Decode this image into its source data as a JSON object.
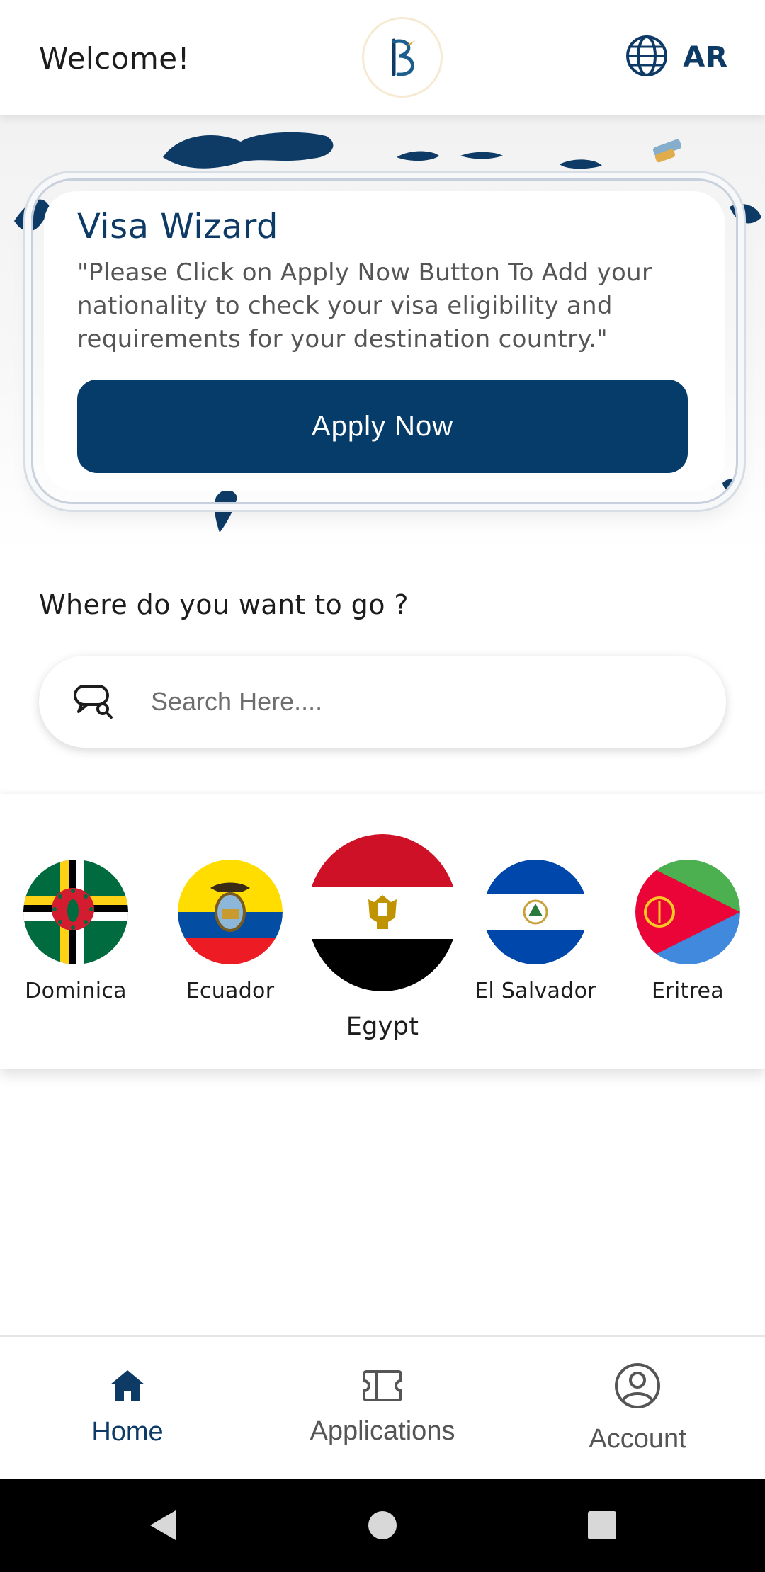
{
  "header": {
    "welcome": "Welcome!",
    "language_label": "AR"
  },
  "wizard": {
    "title": "Visa Wizard",
    "text": "\"Please Click on Apply Now Button To Add your nationality to check your visa eligibility and requirements for your destination country.\"",
    "apply_label": "Apply Now"
  },
  "destination": {
    "title": "Where do you want to go ?",
    "search_placeholder": "Search Here...."
  },
  "countries": [
    {
      "name": "Dominica"
    },
    {
      "name": "Ecuador"
    },
    {
      "name": "Egypt",
      "selected": true
    },
    {
      "name": "El Salvador"
    },
    {
      "name": "Eritrea"
    }
  ],
  "nav": {
    "home": "Home",
    "applications": "Applications",
    "account": "Account"
  },
  "colors": {
    "primary": "#063c6a",
    "accent_text": "#0d3b66"
  },
  "icons": [
    "globe-icon",
    "search-icon",
    "home-icon",
    "ticket-icon",
    "account-icon",
    "back-icon",
    "home-circle-icon",
    "recents-icon"
  ]
}
